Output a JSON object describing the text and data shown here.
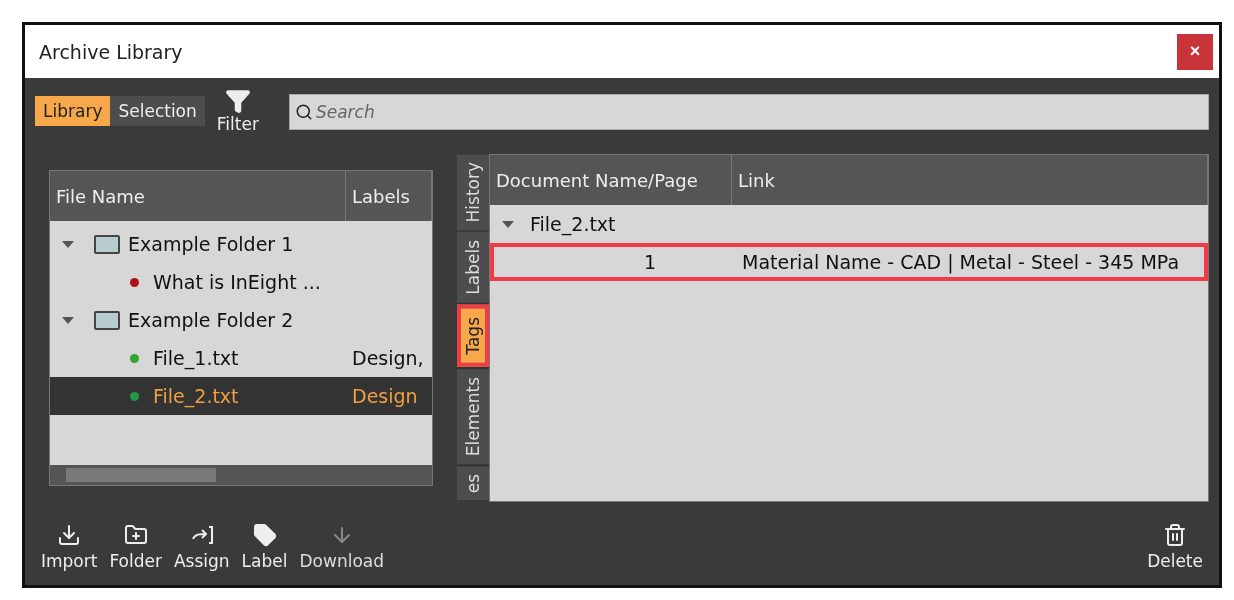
{
  "window": {
    "title": "Archive Library",
    "close": "×"
  },
  "modes": [
    {
      "label": "Library",
      "selected": true
    },
    {
      "label": "Selection",
      "selected": false
    }
  ],
  "filter": {
    "label": "Filter"
  },
  "search": {
    "placeholder": "Search"
  },
  "tree": {
    "columns": [
      "File Name",
      "Labels"
    ],
    "items": [
      {
        "kind": "folder",
        "name": "Example Folder 1",
        "expanded": true,
        "selected": false,
        "children": [
          {
            "kind": "file",
            "name": "What is InEight ...",
            "color": "#b01010",
            "selected": false
          }
        ]
      },
      {
        "kind": "folder",
        "name": "Example Folder 2",
        "expanded": true,
        "selected": false,
        "children": [
          {
            "kind": "file",
            "name": "File_1.txt",
            "labels": "Design,",
            "color": "#2ea82e",
            "selected": false
          },
          {
            "kind": "file",
            "name": "File_2.txt",
            "labels": "Design",
            "color": "#1f9a4a",
            "selected": true
          }
        ]
      }
    ]
  },
  "side_tabs": [
    {
      "label": "History",
      "selected": false,
      "highlighted": false
    },
    {
      "label": "Labels",
      "selected": false,
      "highlighted": false
    },
    {
      "label": "Tags",
      "selected": true,
      "highlighted": true
    },
    {
      "label": "Elements",
      "selected": false,
      "highlighted": false
    },
    {
      "label": "es",
      "selected": false,
      "highlighted": false
    }
  ],
  "links": {
    "columns": [
      "Document Name/Page",
      "Link"
    ],
    "groups": [
      {
        "name": "File_2.txt",
        "expanded": true,
        "rows": [
          {
            "page": "1",
            "link": "Material Name - CAD | Metal - Steel - 345 MPa",
            "highlighted": true
          }
        ]
      }
    ]
  },
  "toolbar": [
    {
      "kind": "import",
      "label": "Import",
      "disabled": false
    },
    {
      "kind": "folder",
      "label": "Folder",
      "disabled": false
    },
    {
      "kind": "assign",
      "label": "Assign",
      "disabled": false
    },
    {
      "kind": "label",
      "label": "Label",
      "disabled": false
    },
    {
      "kind": "download",
      "label": "Download",
      "disabled": true
    },
    {
      "kind": "spacer"
    },
    {
      "kind": "delete",
      "label": "Delete",
      "disabled": false
    }
  ]
}
